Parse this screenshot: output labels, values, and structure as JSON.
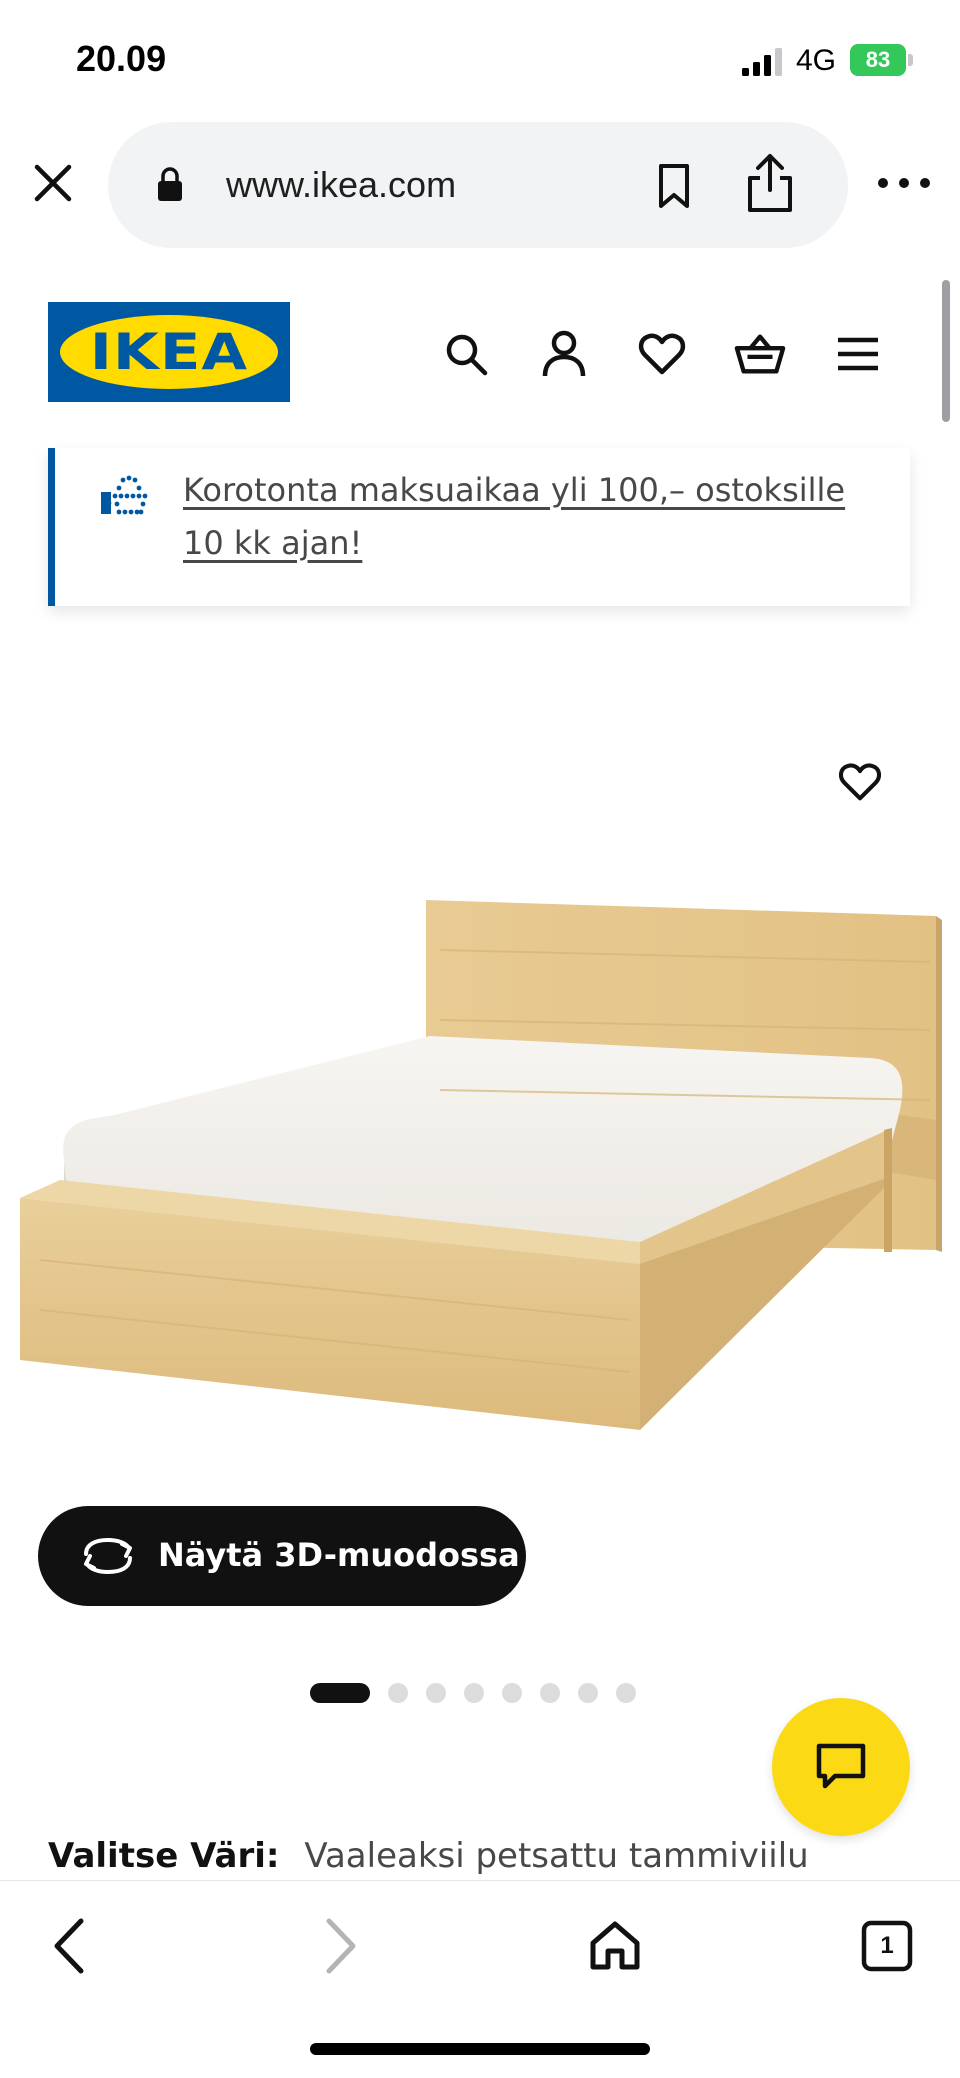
{
  "status_bar": {
    "time": "20.09",
    "network": "4G",
    "battery": "83"
  },
  "browser": {
    "url": "www.ikea.com"
  },
  "header": {
    "logo_text": "IKEA",
    "brand_colors": {
      "blue": "#0058a3",
      "yellow": "#ffdb00"
    }
  },
  "banner": {
    "text": "Korotonta maksuaikaa yli 100,– ostoksille 10 kk ajan!"
  },
  "product": {
    "view_3d_label": "Näytä 3D-muodossa",
    "image_count": 8,
    "active_image_index": 0,
    "color_label": "Valitse Väri:",
    "color_value": "Vaaleaksi petsattu tammiviilu"
  },
  "toolbar": {
    "tab_count": "1"
  },
  "colors": {
    "chat_button": "#fbd914",
    "battery": "#34c759"
  }
}
